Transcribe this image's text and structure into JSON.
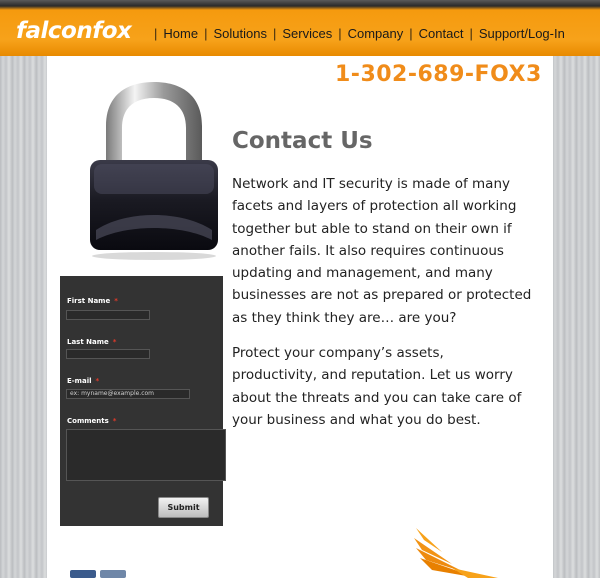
{
  "brand": {
    "logo_text": "falconfox",
    "accent_color": "#f7a21a",
    "phone_color": "#f08c1a"
  },
  "nav": {
    "items": [
      {
        "label": "Home"
      },
      {
        "label": "Solutions"
      },
      {
        "label": "Services"
      },
      {
        "label": "Company"
      },
      {
        "label": "Contact"
      },
      {
        "label": "Support/Log-In"
      }
    ],
    "separator": "|"
  },
  "phone": "1-302-689-FOX3",
  "main": {
    "heading": "Contact Us",
    "paragraph1": "Network and IT security is made of many facets and layers of protection all working together but able to stand on their own if another fails. It also requires continuous updating and management, and many businesses are not as prepared or protected as they think they are… are you?",
    "paragraph2": "Protect your company’s assets, productivity, and reputation. Let us worry about the threats and you can take care of your business and what you do best."
  },
  "form": {
    "first_name_label": "First Name",
    "last_name_label": "Last Name",
    "email_label": "E-mail",
    "email_placeholder": "ex: myname@example.com",
    "comments_label": "Comments",
    "required_marker": "*",
    "submit_label": "Submit"
  },
  "icons": {
    "lock": "padlock-icon",
    "falcon": "falcon-wing-icon",
    "social": [
      "facebook-icon",
      "social-icon"
    ]
  }
}
